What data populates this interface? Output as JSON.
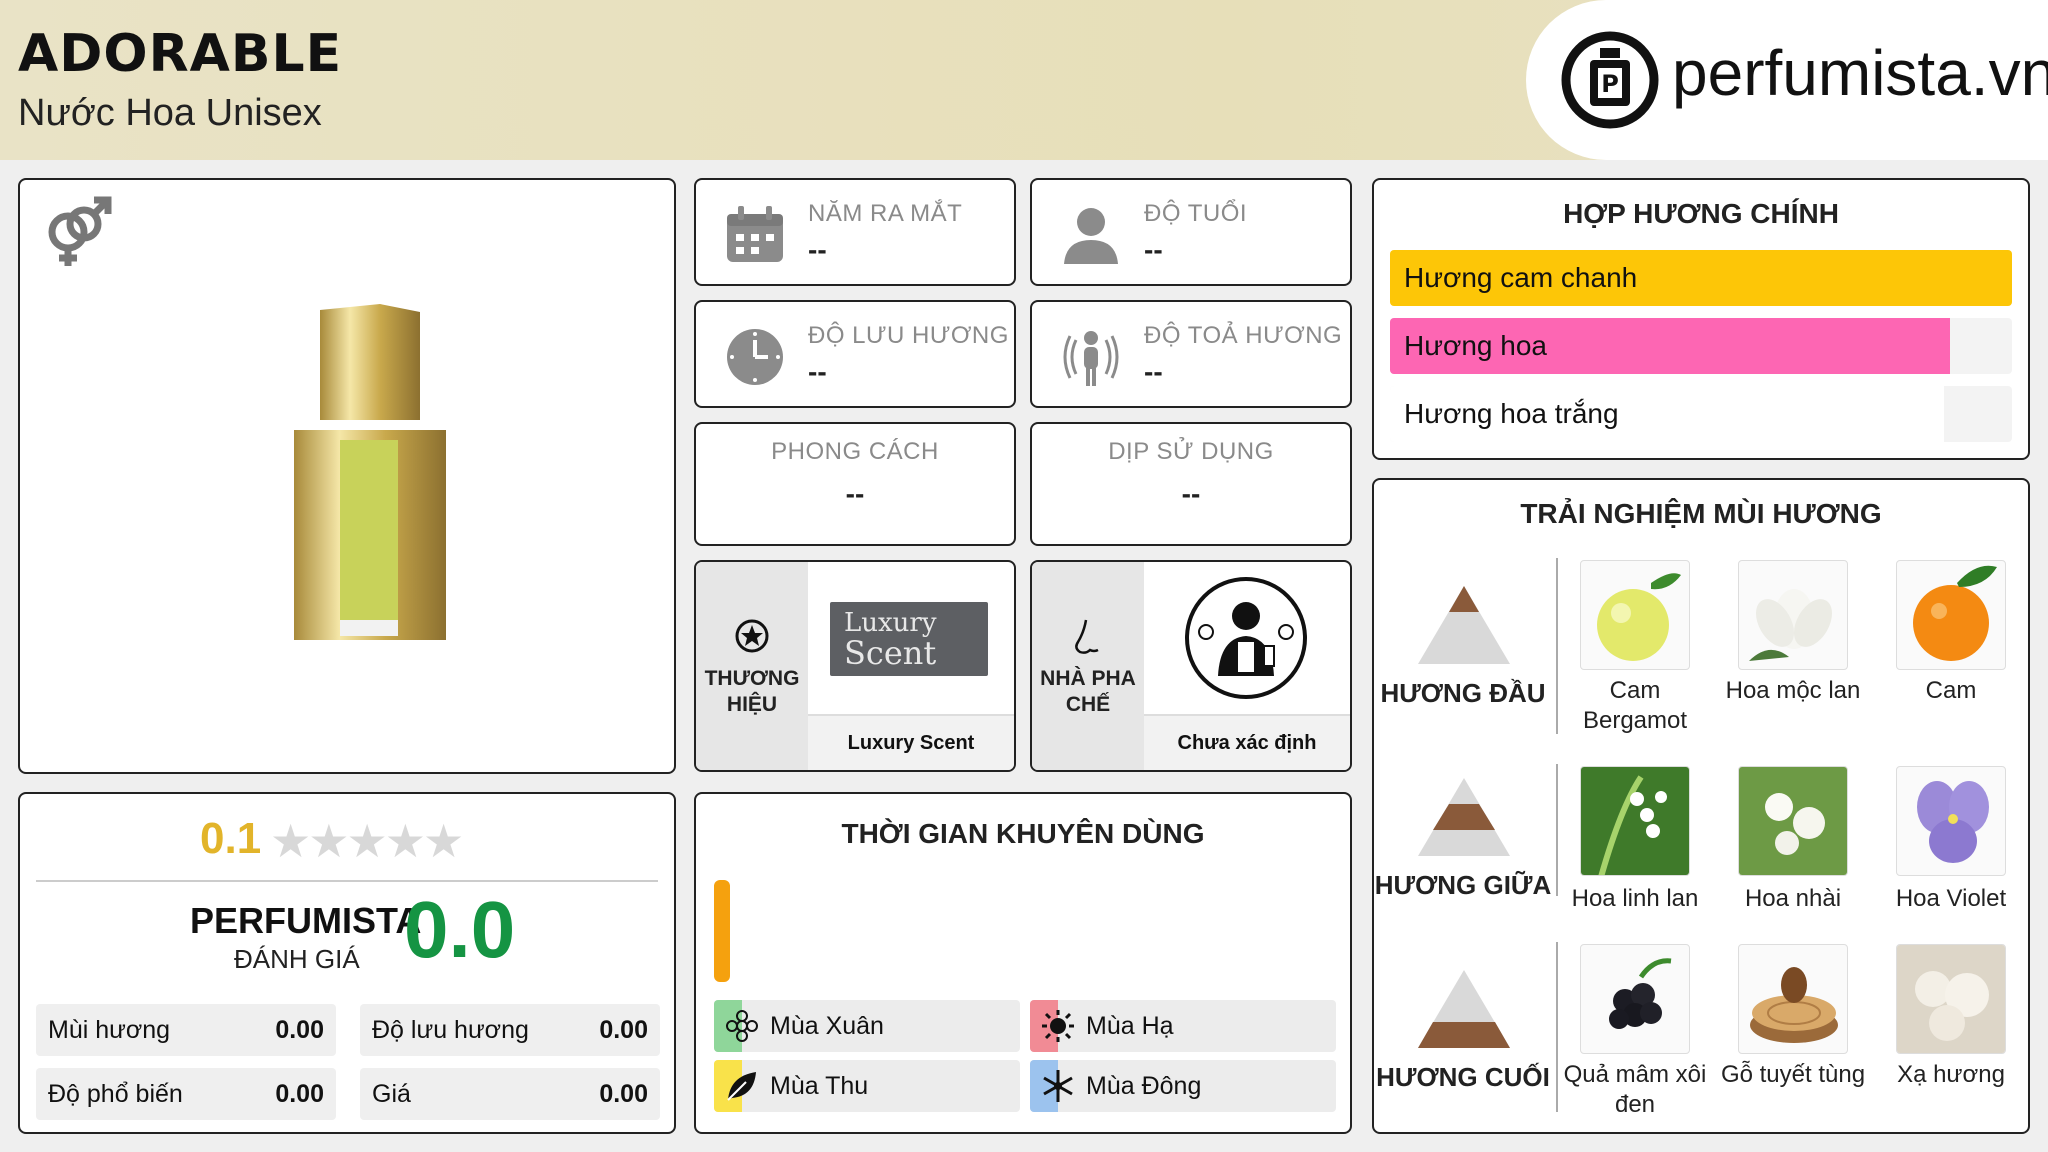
{
  "header": {
    "title": "ADORABLE",
    "subtitle": "Nước Hoa Unisex",
    "logo_text": "perfumista.vn"
  },
  "product": {
    "bottle_label": "Luxury Scent"
  },
  "info": {
    "release_year": {
      "label": "NĂM RA MẮT",
      "value": "--"
    },
    "age": {
      "label": "ĐỘ TUỔI",
      "value": "--"
    },
    "longevity": {
      "label": "ĐỘ LƯU HƯƠNG",
      "value": "--"
    },
    "sillage": {
      "label": "ĐỘ TOẢ HƯƠNG",
      "value": "--"
    },
    "style": {
      "label": "PHONG CÁCH",
      "value": "--"
    },
    "occasion": {
      "label": "DỊP SỬ DỤNG",
      "value": "--"
    }
  },
  "brand": {
    "label_line1": "THƯƠNG",
    "label_line2": "HIỆU",
    "logo_line1": "Luxury",
    "logo_line2": "Scent",
    "name": "Luxury Scent"
  },
  "perfumer": {
    "label_line1": "NHÀ PHA",
    "label_line2": "CHẾ",
    "name": "Chưa xác định"
  },
  "accords": {
    "title": "HỢP HƯƠNG CHÍNH",
    "items": [
      {
        "label": "Hương cam chanh",
        "fill": 1.0,
        "color": "#fdc607"
      },
      {
        "label": "Hương hoa",
        "fill": 0.9,
        "color": "#fd66b3"
      },
      {
        "label": "Hương hoa trắng",
        "fill": 0.89,
        "color": "#ffffff"
      }
    ]
  },
  "notes": {
    "title": "TRẢI NGHIỆM MÙI HƯƠNG",
    "top": {
      "label": "HƯƠNG ĐẦU",
      "items": [
        "Cam Bergamot",
        "Hoa mộc lan",
        "Cam"
      ]
    },
    "middle": {
      "label": "HƯƠNG GIỮA",
      "items": [
        "Hoa linh lan",
        "Hoa nhài",
        "Hoa Violet"
      ]
    },
    "base": {
      "label": "HƯƠNG CUỐI",
      "items": [
        "Quả mâm xôi đen",
        "Gỗ tuyết tùng",
        "Xạ hương"
      ]
    }
  },
  "rating": {
    "user_score": "0.1",
    "stars": "★★★★★",
    "perfumista_label": "PERFUMISTA",
    "perfumista_sub": "ĐÁNH GIÁ",
    "perfumista_score": "0.0",
    "metrics": [
      {
        "label": "Mùi hương",
        "value": "0.00"
      },
      {
        "label": "Độ lưu hương",
        "value": "0.00"
      },
      {
        "label": "Độ phổ biến",
        "value": "0.00"
      },
      {
        "label": "Giá",
        "value": "0.00"
      }
    ]
  },
  "usage": {
    "title": "THỜI GIAN KHUYÊN DÙNG",
    "bar_color": "#f5a10e",
    "seasons": [
      {
        "label": "Mùa Xuân",
        "color": "#8fd69a",
        "icon": "flower-icon"
      },
      {
        "label": "Mùa Hạ",
        "color": "#f18b95",
        "icon": "sun-icon"
      },
      {
        "label": "Mùa Thu",
        "color": "#f9e24a",
        "icon": "leaf-icon"
      },
      {
        "label": "Mùa Đông",
        "color": "#9cc3ee",
        "icon": "snowflake-icon"
      }
    ]
  }
}
